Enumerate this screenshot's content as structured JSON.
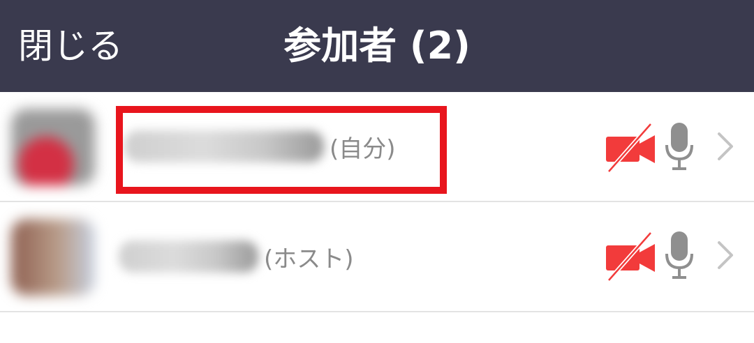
{
  "header": {
    "close_label": "閉じる",
    "title": "参加者 (2)"
  },
  "participants": [
    {
      "role": "(自分)",
      "video_icon": "video-off-icon",
      "mic_icon": "microphone-icon",
      "status_color": "#f23b3b"
    },
    {
      "role": "(ホスト)",
      "video_icon": "video-off-icon",
      "mic_icon": "microphone-icon",
      "status_color": "#f23b3b"
    }
  ],
  "colors": {
    "header_bg": "#3a3a4e",
    "highlight": "#e8151d",
    "video_off": "#f23b3b",
    "mic": "#8f8f8f"
  }
}
